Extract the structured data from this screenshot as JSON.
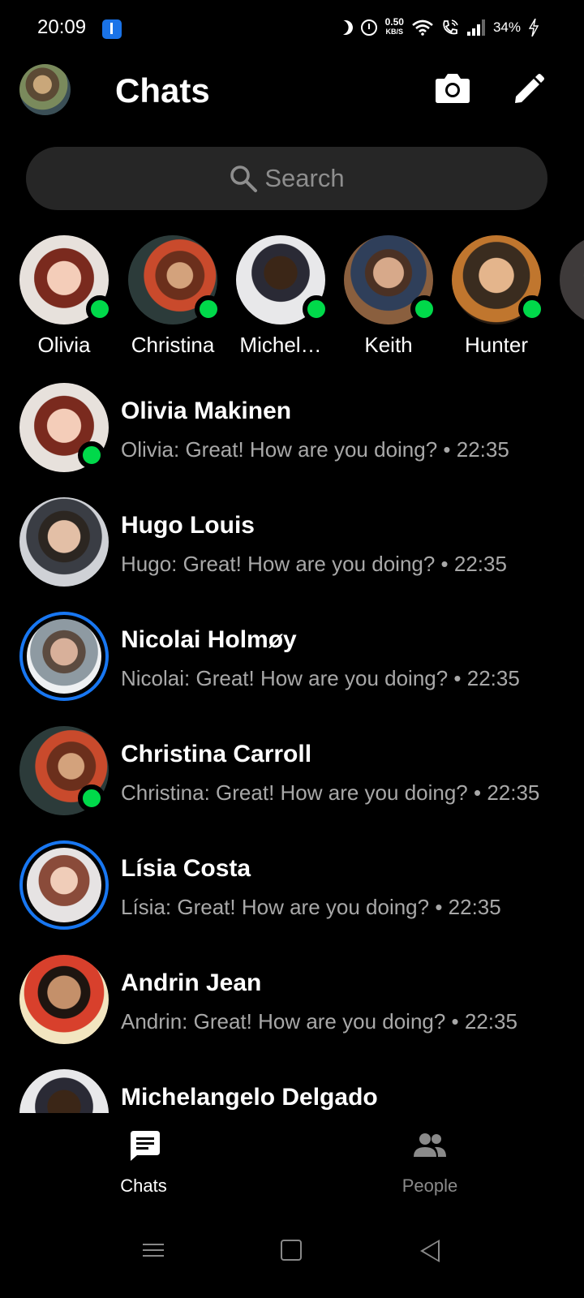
{
  "status_bar": {
    "time": "20:09",
    "network_speed_value": "0.50",
    "network_speed_unit": "KB/S",
    "battery": "34%",
    "icons": [
      "usb-icon",
      "moon-icon",
      "alarm-icon",
      "wifi-icon",
      "wifi-call-icon",
      "signal-icon",
      "charging-icon"
    ]
  },
  "header": {
    "title": "Chats",
    "icons": [
      "camera-icon",
      "edit-icon"
    ]
  },
  "search": {
    "placeholder": "Search"
  },
  "active_now": [
    {
      "name": "Olivia",
      "online": true
    },
    {
      "name": "Christina",
      "online": true
    },
    {
      "name": "Michel…",
      "online": true
    },
    {
      "name": "Keith",
      "online": true
    },
    {
      "name": "Hunter",
      "online": true
    }
  ],
  "chats": [
    {
      "name": "Olivia Makinen",
      "preview": "Olivia: Great! How are you doing? • 22:35",
      "online": true,
      "story": false
    },
    {
      "name": "Hugo Louis",
      "preview": "Hugo: Great! How are you doing? • 22:35",
      "online": false,
      "story": false
    },
    {
      "name": "Nicolai Holmøy",
      "preview": "Nicolai: Great! How are you doing? • 22:35",
      "online": false,
      "story": true
    },
    {
      "name": "Christina Carroll",
      "preview": "Christina: Great! How are you doing? • 22:35",
      "online": true,
      "story": false
    },
    {
      "name": "Lísia Costa",
      "preview": "Lísia: Great! How are you doing? • 22:35",
      "online": false,
      "story": true
    },
    {
      "name": "Andrin Jean",
      "preview": "Andrin: Great! How are you doing? • 22:35",
      "online": false,
      "story": false
    },
    {
      "name": "Michelangelo Delgado",
      "preview": "",
      "online": false,
      "story": false
    }
  ],
  "bottom_nav": {
    "chats_label": "Chats",
    "people_label": "People",
    "active": "Chats"
  },
  "colors": {
    "background": "#000000",
    "online": "#00d94a",
    "story_ring": "#1877f2",
    "secondary_text": "#a8a8a8",
    "search_bg": "#262626"
  }
}
